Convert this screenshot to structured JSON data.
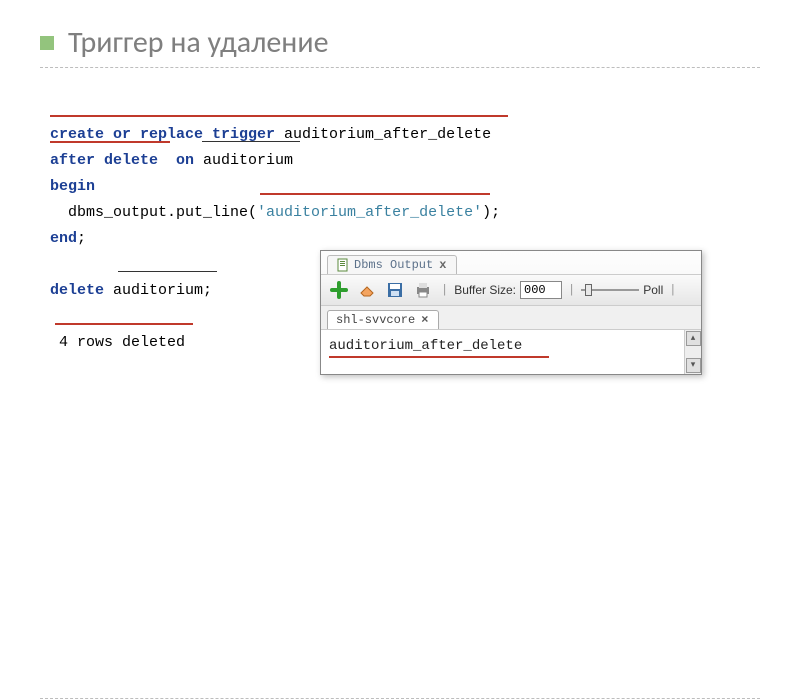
{
  "slide": {
    "title": "Триггер на удаление"
  },
  "code": {
    "l1a": "create or replace trigger",
    "l1b": " auditorium_after_delete",
    "l2a": "after delete ",
    "l2b": " on ",
    "l2c": "auditorium",
    "l3": "begin",
    "l4a": "  dbms_output.put_line(",
    "l4b": "'auditorium_after_delete'",
    "l4c": ");",
    "l5": "end",
    "l5b": ";",
    "l7a": "delete",
    "l7b": " auditorium;",
    "l9": " 4 rows deleted"
  },
  "panel": {
    "tab_label": "Dbms Output",
    "buffer_label": "Buffer Size:",
    "buffer_value": "000",
    "poll_label": "Poll",
    "conn_tab": "shl-svvcore",
    "output_line": "auditorium_after_delete"
  },
  "icons": {
    "doc": "doc-icon",
    "plus": "plus-icon",
    "eraser": "eraser-icon",
    "save": "save-icon",
    "print": "print-icon"
  }
}
